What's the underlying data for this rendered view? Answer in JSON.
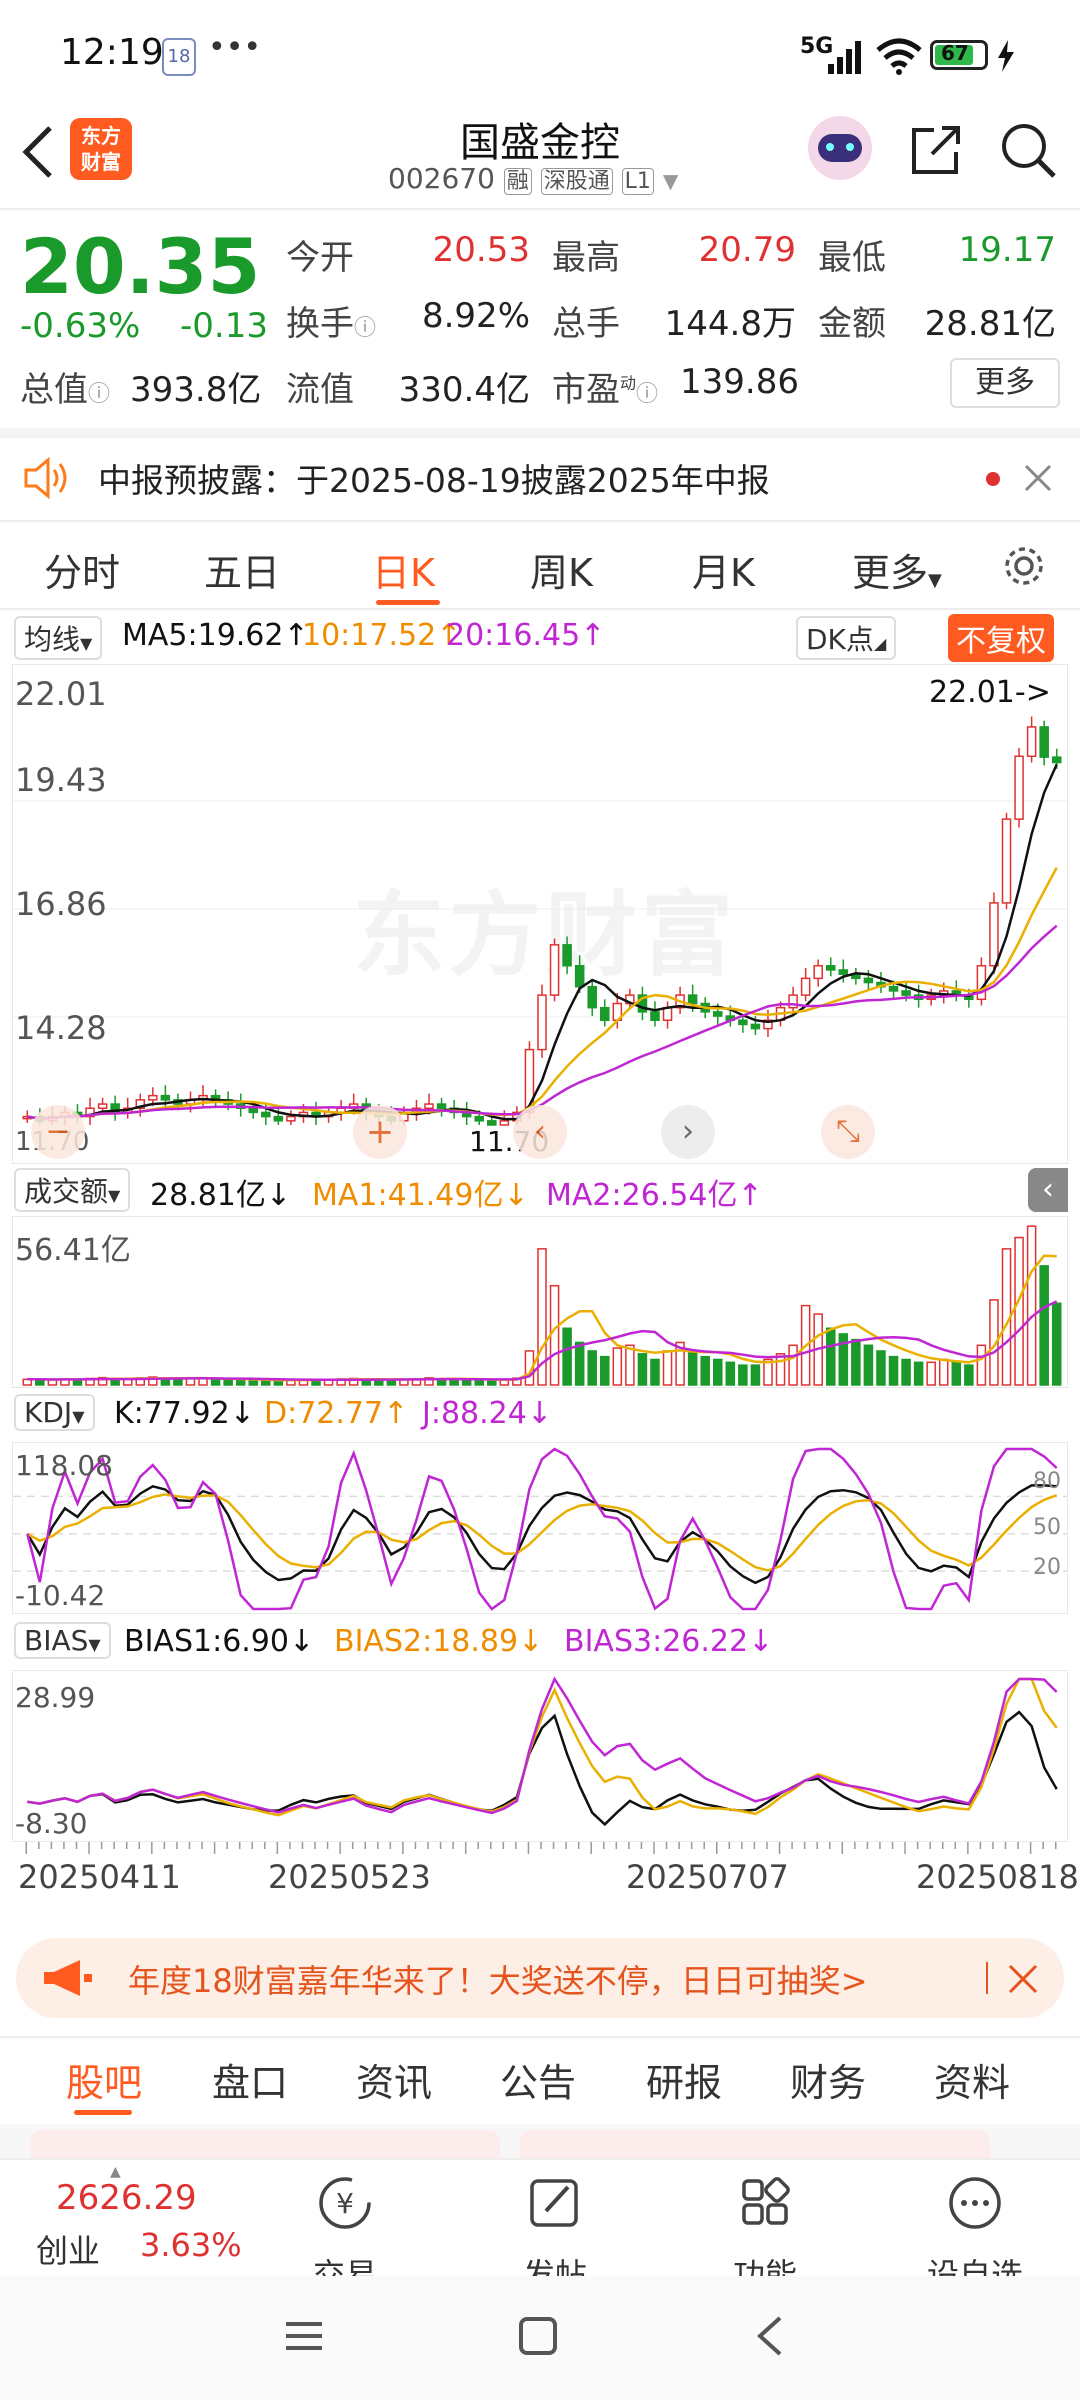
{
  "status_bar": {
    "time": "12:19",
    "notif_badge": "18",
    "more": "•••",
    "network": "5G",
    "battery": "67"
  },
  "header": {
    "title": "国盛金控",
    "code": "002670",
    "tags": [
      "融",
      "深股通",
      "L1"
    ]
  },
  "quote": {
    "price": "20.35",
    "change_pct": "-0.63%",
    "change": "-0.13",
    "open_label": "今开",
    "open": "20.53",
    "high_label": "最高",
    "high": "20.79",
    "low_label": "最低",
    "low": "19.17",
    "turnover_label": "换手",
    "turnover": "8.92%",
    "volume_label": "总手",
    "volume": "144.8万",
    "amount_label": "金额",
    "amount": "28.81亿",
    "mktcap_label": "总值",
    "mktcap": "393.8亿",
    "float_label": "流值",
    "float": "330.4亿",
    "pe_label": "市盈",
    "pe_sup": "动",
    "pe": "139.86",
    "more_button": "更多"
  },
  "notice": {
    "text": "中报预披露：于2025-08-19披露2025年中报"
  },
  "chart_tabs": [
    "分时",
    "五日",
    "日K",
    "周K",
    "月K",
    "更多"
  ],
  "active_chart_tab": "日K",
  "ma_bar": {
    "selector": "均线",
    "ma5": "MA5:19.62",
    "ma10": "10:17.52",
    "ma20": "20:16.45",
    "dk": "DK点",
    "fq": "不复权"
  },
  "vol_bar": {
    "selector": "成交额",
    "value": "28.81亿",
    "ma1": "MA1:41.49亿",
    "ma2": "MA2:26.54亿"
  },
  "kdj_bar": {
    "selector": "KDJ",
    "k": "K:77.92",
    "d": "D:72.77",
    "j": "J:88.24"
  },
  "bias_bar": {
    "selector": "BIAS",
    "b1": "BIAS1:6.90",
    "b2": "BIAS2:18.89",
    "b3": "BIAS3:26.22"
  },
  "promo": {
    "text": "年度18财富嘉年华来了！大奖送不停，日日可抽奖>"
  },
  "bottom_tabs": [
    "股吧",
    "盘口",
    "资讯",
    "公告",
    "研报",
    "财务",
    "资料"
  ],
  "active_bottom_tab": "股吧",
  "toolbar": {
    "index_value": "2626.29",
    "index_name": "创业",
    "index_pct": "3.63%",
    "items": [
      "交易",
      "发帖",
      "功能",
      "设自选"
    ]
  },
  "watermark": "东方财富",
  "chart_data": [
    {
      "type": "candlestick",
      "title": "日K",
      "ylim": [
        11.7,
        22.01
      ],
      "y_ticks": [
        "22.01",
        "19.43",
        "16.86",
        "14.28",
        "11.70"
      ],
      "annotations": [
        "22.01->",
        "11.70"
      ],
      "x_ticks": [
        "20250411",
        "20250523",
        "20250707",
        "20250818"
      ],
      "close": [
        11.9,
        11.8,
        11.9,
        12.0,
        11.9,
        12.1,
        12.2,
        12.0,
        12.1,
        12.3,
        12.4,
        12.3,
        12.2,
        12.3,
        12.4,
        12.3,
        12.2,
        12.1,
        12.0,
        11.9,
        11.8,
        11.9,
        12.0,
        11.9,
        12.0,
        12.1,
        12.2,
        12.0,
        11.9,
        11.8,
        12.0,
        12.1,
        12.2,
        12.1,
        12.0,
        11.9,
        11.8,
        11.7,
        11.8,
        12.0,
        13.5,
        14.8,
        16.0,
        15.5,
        15.0,
        14.5,
        14.2,
        14.6,
        14.8,
        14.4,
        14.2,
        14.5,
        14.8,
        14.6,
        14.4,
        14.3,
        14.2,
        14.1,
        14.0,
        14.2,
        14.5,
        14.8,
        15.2,
        15.5,
        15.4,
        15.3,
        15.2,
        15.1,
        15.0,
        14.9,
        14.8,
        14.7,
        14.8,
        14.9,
        14.8,
        14.7,
        15.5,
        17.0,
        19.0,
        20.5,
        21.2,
        20.48,
        20.35
      ],
      "series": [
        {
          "name": "MA5",
          "value": "19.62"
        },
        {
          "name": "MA10",
          "value": "17.52"
        },
        {
          "name": "MA20",
          "value": "16.45"
        }
      ]
    },
    {
      "type": "bar",
      "title": "成交额",
      "ylim": [
        0,
        56.41
      ],
      "y_ticks": [
        "56.41亿"
      ],
      "values": [
        2,
        2,
        1.8,
        2.1,
        1.9,
        2.3,
        2.6,
        2,
        2.1,
        2.5,
        2.8,
        2.4,
        2.2,
        2.3,
        2.4,
        2.1,
        1.9,
        1.8,
        1.7,
        1.6,
        1.7,
        1.8,
        1.9,
        1.8,
        1.9,
        2.1,
        2.3,
        2.0,
        1.8,
        1.7,
        2.0,
        2.2,
        2.5,
        2.2,
        2.0,
        1.9,
        1.8,
        1.7,
        1.9,
        2.4,
        12,
        48,
        35,
        20,
        15,
        12,
        10,
        13,
        14,
        11,
        9,
        12,
        15,
        12,
        10,
        9,
        8,
        7,
        7,
        9,
        11,
        14,
        28,
        25,
        20,
        18,
        16,
        14,
        12,
        10,
        9,
        8,
        8,
        9,
        8,
        7,
        14,
        30,
        48,
        52,
        56,
        42,
        28.81
      ]
    },
    {
      "type": "line",
      "title": "KDJ",
      "ylim": [
        -10.42,
        118.08
      ],
      "y_ticks": [
        "118.08",
        "80",
        "50",
        "20",
        "-10.42"
      ],
      "series": [
        {
          "name": "K",
          "value": "77.92"
        },
        {
          "name": "D",
          "value": "72.77"
        },
        {
          "name": "J",
          "value": "88.24"
        }
      ]
    },
    {
      "type": "line",
      "title": "BIAS",
      "ylim": [
        -8.3,
        28.99
      ],
      "y_ticks": [
        "28.99",
        "-8.30"
      ],
      "series": [
        {
          "name": "BIAS1",
          "value": "6.90"
        },
        {
          "name": "BIAS2",
          "value": "18.89"
        },
        {
          "name": "BIAS3",
          "value": "26.22"
        }
      ]
    }
  ]
}
